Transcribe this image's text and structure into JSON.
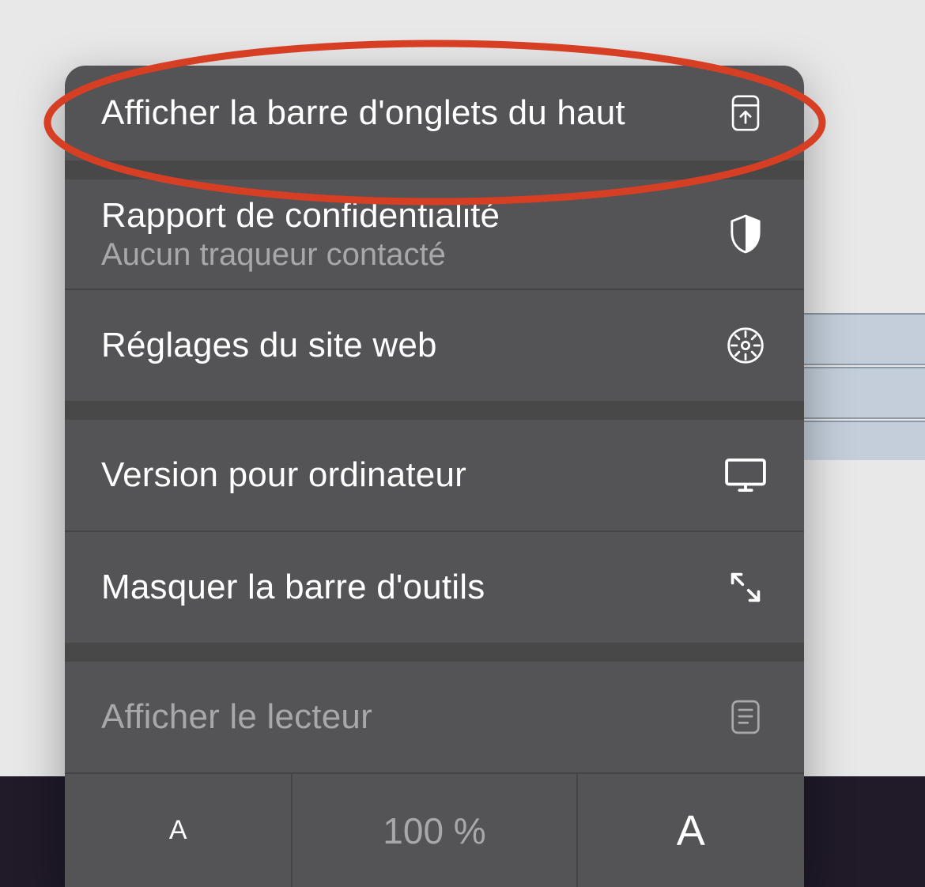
{
  "menu": {
    "show_top_tab_bar": "Afficher la barre d'onglets du haut",
    "privacy_report": {
      "title": "Rapport de confidentialité",
      "subtitle": "Aucun traqueur contacté"
    },
    "website_settings": "Réglages du site web",
    "desktop_version": "Version pour ordinateur",
    "hide_toolbar": "Masquer la barre d'outils",
    "show_reader": "Afficher le lecteur",
    "zoom": {
      "small_label": "A",
      "percent": "100 %",
      "large_label": "A"
    }
  },
  "annotation_color": "#d63f24"
}
